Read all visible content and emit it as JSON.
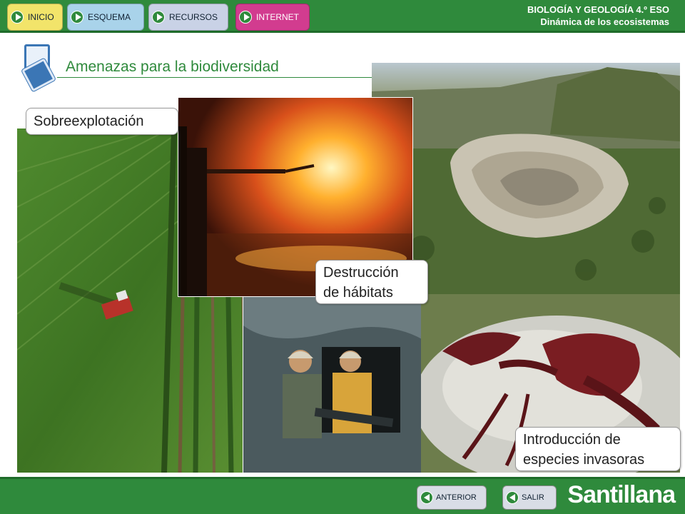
{
  "header": {
    "nav": [
      {
        "label": "INICIO"
      },
      {
        "label": "ESQUEMA"
      },
      {
        "label": "RECURSOS"
      },
      {
        "label": "INTERNET"
      }
    ],
    "subject": "BIOLOGÍA Y GEOLOGÍA 4.º ESO",
    "unit": "Dinámica de los ecosistemas"
  },
  "main": {
    "title": "Amenazas para la biodiversidad",
    "callouts": {
      "overexploitation": "Sobreexplotación",
      "habitat_line1": "Destrucción",
      "habitat_line2": "de hábitats",
      "invasive_line1": "Introducción de",
      "invasive_line2": "especies invasoras"
    }
  },
  "footer": {
    "prev_label": "ANTERIOR",
    "exit_label": "SALIR",
    "brand": "Santillana"
  },
  "colors": {
    "brand_green": "#2f8a3c",
    "title_green": "#2f8a3c",
    "internet_pink": "#d23c8f"
  }
}
